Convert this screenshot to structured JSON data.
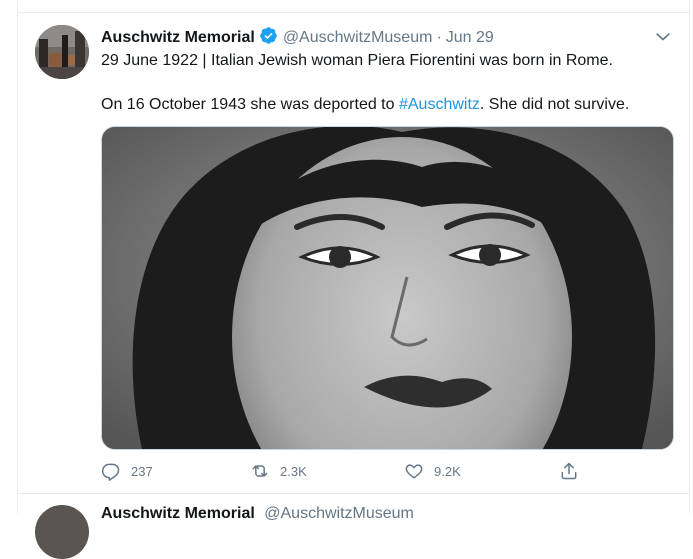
{
  "tweet": {
    "author_name": "Auschwitz Memorial",
    "author_handle": "@AuschwitzMuseum",
    "separator": "·",
    "date": "Jun 29",
    "line1": "29 June 1922 | Italian Jewish woman Piera Fiorentini was born in Rome.",
    "line2_before": "On 16 October 1943 she was deported to ",
    "line2_hashtag": "#Auschwitz",
    "line2_after": ". She did not survive.",
    "actions": {
      "replies": "237",
      "retweets": "2.3K",
      "likes": "9.2K"
    },
    "icons": {
      "verified": "verified-badge-icon",
      "caret": "chevron-down-icon",
      "reply": "reply-icon",
      "retweet": "retweet-icon",
      "like": "heart-icon",
      "share": "share-icon"
    }
  },
  "next_tweet": {
    "author_name": "Auschwitz Memorial",
    "author_handle": "@AuschwitzMuseum"
  },
  "colors": {
    "accent": "#1b95e0",
    "verified": "#1da1f2",
    "secondary_text": "#657786",
    "border": "#e6ecf0"
  }
}
